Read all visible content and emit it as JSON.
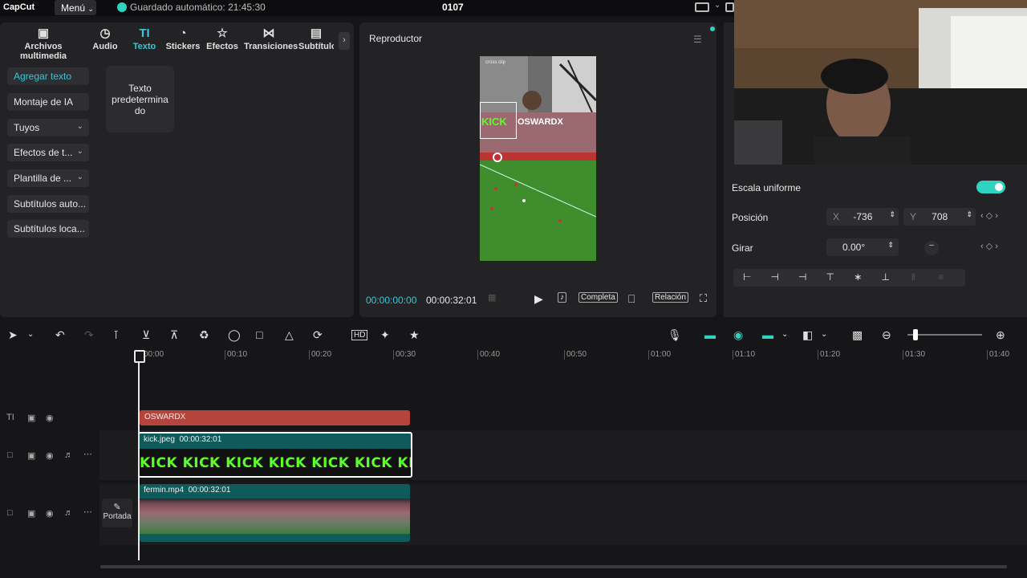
{
  "topbar": {
    "logo": "CapCut",
    "menu": "Menú",
    "autosave": "Guardado automático: 21:45:30",
    "project_name": "0107"
  },
  "media_tabs": [
    {
      "label": "Archivos multimedia",
      "icon": "media-icon"
    },
    {
      "label": "Audio",
      "icon": "audio-icon"
    },
    {
      "label": "Texto",
      "icon": "text-icon"
    },
    {
      "label": "Stickers",
      "icon": "sticker-icon"
    },
    {
      "label": "Efectos",
      "icon": "effects-icon"
    },
    {
      "label": "Transiciones",
      "icon": "transitions-icon"
    },
    {
      "label": "Subtítulo",
      "icon": "subtitles-icon"
    }
  ],
  "text_menu": [
    {
      "label": "Agregar texto"
    },
    {
      "label": "Montaje de IA"
    },
    {
      "label": "Tuyos"
    },
    {
      "label": "Efectos de t..."
    },
    {
      "label": "Plantilla de ..."
    },
    {
      "label": "Subtítulos auto..."
    },
    {
      "label": "Subtítulos loca..."
    }
  ],
  "default_text_card": "Texto predetermina do",
  "player": {
    "title": "Reproductor",
    "current_time": "00:00:00:00",
    "total_time": "00:00:32:01",
    "full_label": "Completa",
    "ratio_label": "Relación",
    "overlay_text": "OSWARDX",
    "overlay_kick": "KICK",
    "watermark": "cross clip"
  },
  "properties": {
    "uniform_scale_label": "Escala uniforme",
    "uniform_scale_on": true,
    "position_label": "Posición",
    "x_label": "X",
    "x_value": "-736",
    "y_label": "Y",
    "y_value": "708",
    "rotate_label": "Girar",
    "rotate_value": "0.00°"
  },
  "ruler_ticks": [
    "00:00",
    "00:10",
    "00:20",
    "00:30",
    "00:40",
    "00:50",
    "01:00",
    "01:10",
    "01:20",
    "01:30",
    "01:40"
  ],
  "tracks": {
    "text_clip": "OSWARDX",
    "video1": {
      "name": "kick.jpeg",
      "duration": "00:00:32:01",
      "strip": "KICK KICK KICK KICK KICK KICK KICK"
    },
    "video2": {
      "name": "fermin.mp4",
      "duration": "00:00:32:01"
    },
    "cover_label": "Portada"
  },
  "colors": {
    "accent": "#2fd3c1",
    "text_clip": "#b5443c",
    "video_clip": "#0f5b5b",
    "kick_green": "#5aff2a"
  }
}
